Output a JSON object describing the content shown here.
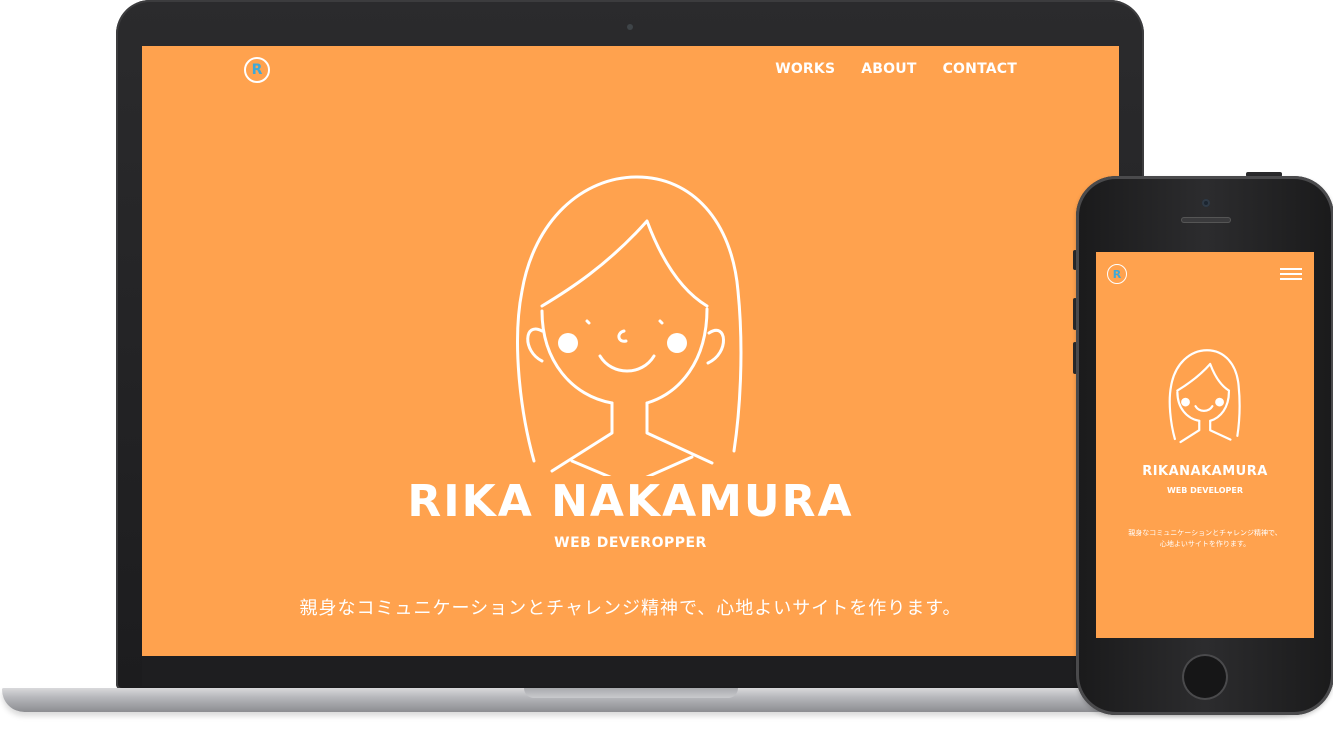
{
  "colors": {
    "accent": "#ffa24e",
    "text_on_accent": "#ffffff",
    "logo_letter": "#3fa9d8"
  },
  "desktop": {
    "logo_letter": "R",
    "nav": [
      "WORKS",
      "ABOUT",
      "CONTACT"
    ],
    "name": "RIKA NAKAMURA",
    "role": "WEB DEVEROPPER",
    "tagline": "親身なコミュニケーションとチャレンジ精神で、心地よいサイトを作ります。"
  },
  "mobile": {
    "logo_letter": "R",
    "menu_icon": "hamburger-menu-icon",
    "name": "RIKANAKAMURA",
    "role": "WEB DEVELOPER",
    "tagline_line1": "親身なコミュニケーションとチャレンジ精神で、",
    "tagline_line2": "心地よいサイトを作ります。"
  }
}
